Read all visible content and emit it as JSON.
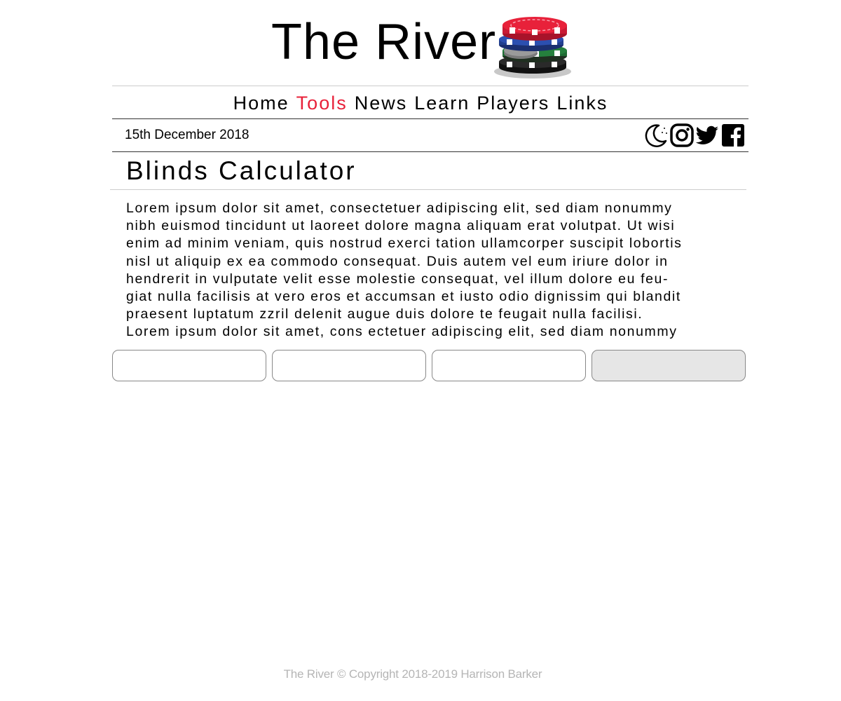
{
  "site": {
    "title": "The River",
    "logo_icon": "poker-chips-icon"
  },
  "nav": {
    "items": [
      {
        "label": "Home",
        "active": false
      },
      {
        "label": "Tools",
        "active": true
      },
      {
        "label": "News",
        "active": false
      },
      {
        "label": "Learn",
        "active": false
      },
      {
        "label": "Players",
        "active": false
      },
      {
        "label": "Links",
        "active": false
      }
    ]
  },
  "topbar": {
    "date": "15th December 2018",
    "icons": [
      "dark-mode-moon-icon",
      "instagram-icon",
      "twitter-icon",
      "facebook-icon"
    ]
  },
  "main": {
    "title": "Blinds Calculator",
    "body_lines": [
      "Lorem ipsum dolor sit amet, consectetuer adipiscing elit, sed diam nonummy",
      "nibh euismod tincidunt ut laoreet dolore magna aliquam erat volutpat. Ut wisi",
      "enim ad minim veniam, quis nostrud exerci tation ullamcorper suscipit lobortis",
      "nisl ut aliquip ex ea commodo consequat. Duis autem vel eum iriure dolor in",
      "hendrerit in vulputate velit esse molestie consequat, vel illum dolore eu feu-",
      "giat nulla facilisis at vero eros et accumsan et iusto odio dignissim qui blandit",
      "praesent luptatum zzril delenit augue duis dolore te feugait nulla facilisi.",
      "Lorem ipsum dolor sit amet, cons ectetuer adipiscing elit, sed diam nonummy"
    ],
    "buttons": [
      {
        "label": "",
        "selected": false
      },
      {
        "label": "",
        "selected": false
      },
      {
        "label": "",
        "selected": false
      },
      {
        "label": "",
        "selected": true
      }
    ]
  },
  "footer": {
    "text": "The River © Copyright 2018-2019 Harrison Barker"
  },
  "colors": {
    "accent": "#e8213a",
    "footer_text": "#b5b5b5",
    "selected_button": "#e6e6e6"
  }
}
